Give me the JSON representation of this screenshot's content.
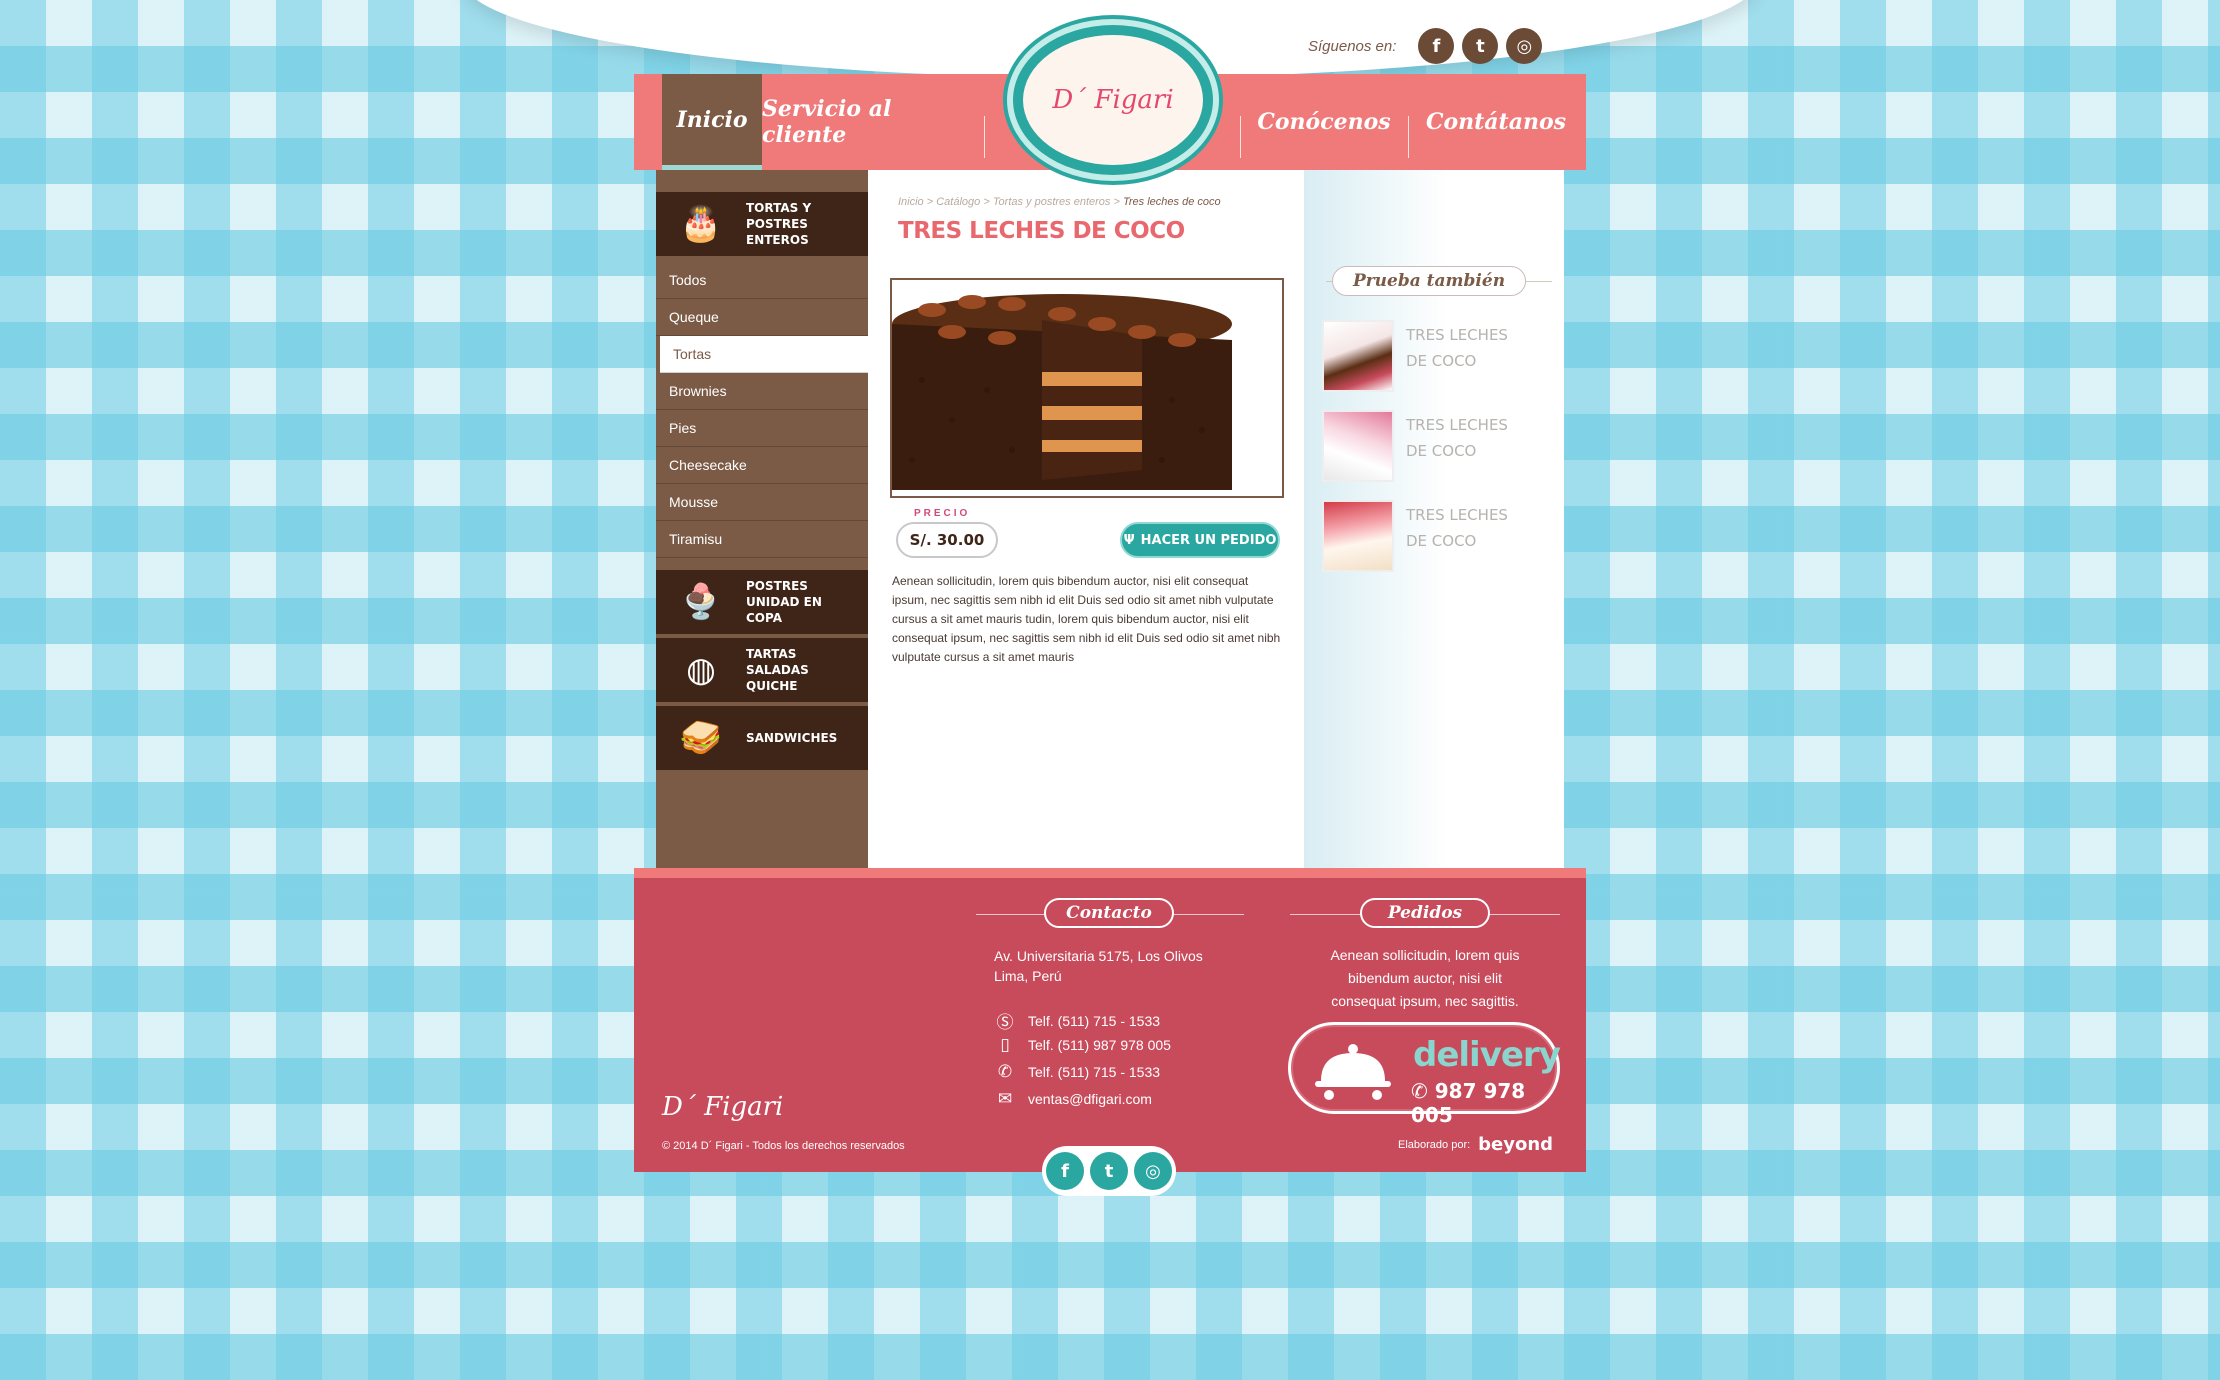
{
  "header": {
    "follow_label": "Síguenos en:",
    "logo_text": "D´ Figari",
    "nav": [
      {
        "label": "Inicio"
      },
      {
        "label": "Servicio al cliente"
      },
      {
        "label": "Conócenos"
      },
      {
        "label": "Contátanos"
      }
    ],
    "social_icons": [
      "facebook-icon",
      "twitter-icon",
      "instagram-icon"
    ]
  },
  "sidebar": {
    "category1": "TORTAS Y POSTRES ENTEROS",
    "items": [
      {
        "label": "Todos"
      },
      {
        "label": "Queque"
      },
      {
        "label": "Tortas"
      },
      {
        "label": "Brownies"
      },
      {
        "label": "Pies"
      },
      {
        "label": "Cheesecake"
      },
      {
        "label": "Mousse"
      },
      {
        "label": "Tiramisu"
      }
    ],
    "active_item": "Tortas",
    "category2": "POSTRES UNIDAD EN COPA",
    "category3": "TARTAS SALADAS QUICHE",
    "category4": "SANDWICHES"
  },
  "breadcrumb": {
    "items": [
      "Inicio",
      "Catálogo",
      "Tortas y postres enteros"
    ],
    "current": "Tres leches de coco"
  },
  "product": {
    "title": "TRES LECHES DE COCO",
    "price_label": "PRECIO",
    "price": "S/. 30.00",
    "order_label": "HACER UN PEDIDO",
    "description": "Aenean sollicitudin, lorem quis bibendum auctor, nisi elit consequat ipsum, nec sagittis sem nibh id elit Duis sed odio sit amet nibh vulputate cursus a sit amet mauris tudin, lorem quis bibendum auctor, nisi elit consequat ipsum, nec sagittis sem nibh id elit Duis sed odio sit amet nibh vulputate cursus a sit amet mauris"
  },
  "related": {
    "title": "Prueba también",
    "items": [
      {
        "name": "TRES LECHES DE COCO"
      },
      {
        "name": "TRES LECHES DE COCO"
      },
      {
        "name": "TRES LECHES DE COCO"
      }
    ]
  },
  "footer": {
    "contact_title": "Contacto",
    "address_line1": "Av. Universitaria 5175, Los Olivos",
    "address_line2": "Lima, Perú",
    "contacts": [
      {
        "icon": "skype-icon",
        "text": "Telf. (511) 715 - 1533"
      },
      {
        "icon": "mobile-icon",
        "text": "Telf. (511) 987 978 005"
      },
      {
        "icon": "phone-icon",
        "text": "Telf. (511) 715 - 1533"
      },
      {
        "icon": "mail-icon",
        "text": "ventas@dfigari.com"
      }
    ],
    "orders_title": "Pedidos",
    "orders_text": "Aenean sollicitudin, lorem quis bibendum auctor, nisi elit consequat ipsum, nec sagittis.",
    "delivery_word": "delivery",
    "delivery_phone": "987 978 005",
    "logo_text": "D´ Figari",
    "copyright": "© 2014 D´ Figari - Todos los derechos reservados",
    "made_by_label": "Elaborado por:",
    "made_by": "beyond"
  },
  "colors": {
    "coral": "#f0797a",
    "brown": "#7b5a46",
    "dark_brown": "#3f2418",
    "teal": "#2aa7a0",
    "footer_red": "#c84b5c"
  }
}
